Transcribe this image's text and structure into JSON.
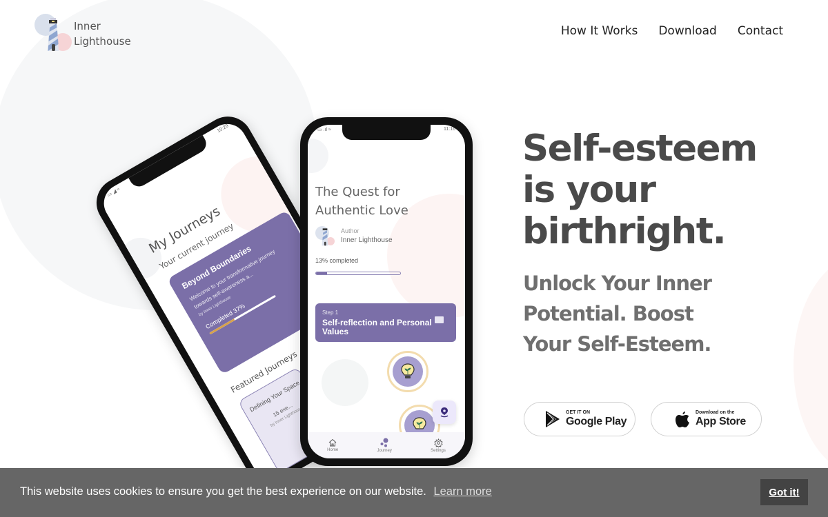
{
  "header": {
    "logo_line1": "Inner",
    "logo_line2": "Lighthouse",
    "nav": [
      {
        "label": "How It Works"
      },
      {
        "label": "Download"
      },
      {
        "label": "Contact"
      }
    ]
  },
  "hero": {
    "title_lines": [
      "Self-esteem",
      "is your",
      "birthright."
    ],
    "subtitle_lines": [
      "Unlock Your Inner",
      "Potential. Boost",
      "Your Self-Esteem."
    ],
    "google_play": {
      "small": "GET IT ON",
      "big": "Google Play",
      "icon": "google-play-icon"
    },
    "app_store": {
      "small": "Download on the",
      "big": "App Store",
      "icon": "apple-icon"
    }
  },
  "phone_back": {
    "time": "10:29",
    "title": "My Journeys",
    "subtitle": "Your current journey",
    "current_journey": {
      "title": "Beyond Boundaries",
      "description": "Welcome to your transformative journey towards self-awareness a...",
      "author": "by Inner Lighthouse",
      "progress_label": "Completed 37%",
      "progress": 0.37
    },
    "featured_title": "Featured Journeys",
    "featured": [
      {
        "title": "Defining Your Space",
        "meta": "15 exe...",
        "author": "by Inner Lighthouse"
      }
    ]
  },
  "phone_front": {
    "time": "11:16",
    "title": "The Quest for Authentic Love",
    "author_label": "Author",
    "author_name": "Inner Lighthouse",
    "progress_label": "13% completed",
    "progress": 0.13,
    "step": {
      "number": "Step 1",
      "title": "Self-reflection and Personal Values"
    },
    "tabs": [
      {
        "label": "Home",
        "icon": "home-icon"
      },
      {
        "label": "Journey",
        "icon": "journey-icon"
      },
      {
        "label": "Settings",
        "icon": "gear-icon"
      }
    ]
  },
  "cookie": {
    "message": "This website uses cookies to ensure you get the best experience on our website.",
    "learn_more": "Learn more",
    "accept": "Got it!"
  },
  "colors": {
    "brand_purple": "#7b6fa8",
    "accent_gold": "#d8a24a",
    "cookie_bg": "#666666",
    "cookie_button": "#434343"
  }
}
